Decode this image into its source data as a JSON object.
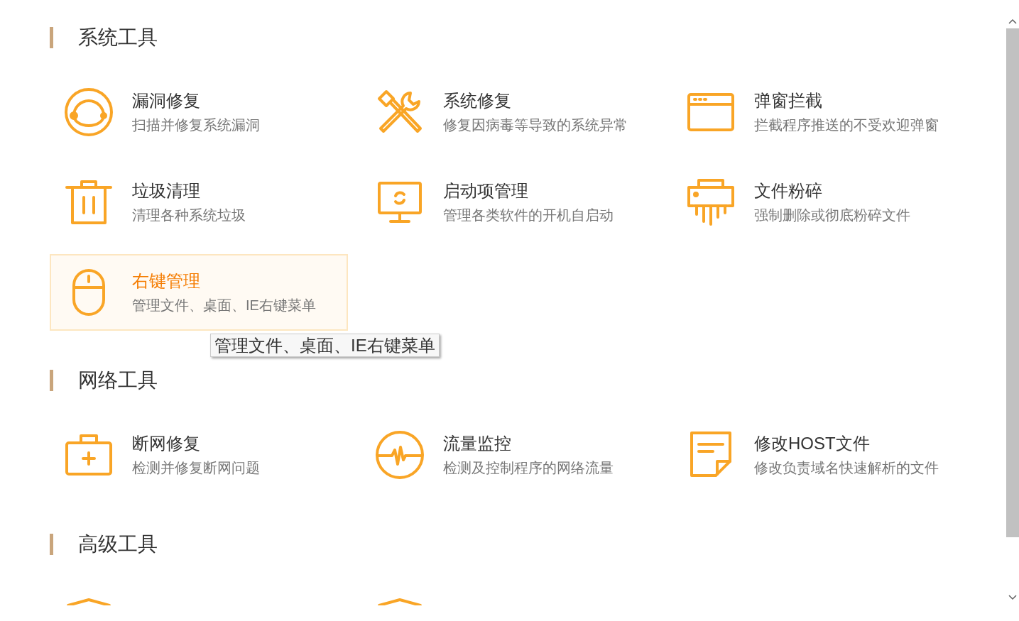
{
  "sections": [
    {
      "title": "系统工具",
      "tools": [
        {
          "kind": "vuln",
          "title": "漏洞修复",
          "desc": "扫描并修复系统漏洞",
          "hovered": false
        },
        {
          "kind": "tools",
          "title": "系统修复",
          "desc": "修复因病毒等导致的系统异常",
          "hovered": false
        },
        {
          "kind": "window",
          "title": "弹窗拦截",
          "desc": "拦截程序推送的不受欢迎弹窗",
          "hovered": false
        },
        {
          "kind": "trash",
          "title": "垃圾清理",
          "desc": "清理各种系统垃圾",
          "hovered": false
        },
        {
          "kind": "monitor",
          "title": "启动项管理",
          "desc": "管理各类软件的开机自启动",
          "hovered": false
        },
        {
          "kind": "shredder",
          "title": "文件粉碎",
          "desc": "强制删除或彻底粉碎文件",
          "hovered": false
        },
        {
          "kind": "mouse",
          "title": "右键管理",
          "desc": "管理文件、桌面、IE右键菜单",
          "hovered": true
        }
      ],
      "tooltip": "管理文件、桌面、IE右键菜单"
    },
    {
      "title": "网络工具",
      "tools": [
        {
          "kind": "medkit",
          "title": "断网修复",
          "desc": "检测并修复断网问题",
          "hovered": false
        },
        {
          "kind": "pulse",
          "title": "流量监控",
          "desc": "检测及控制程序的网络流量",
          "hovered": false
        },
        {
          "kind": "note",
          "title": "修改HOST文件",
          "desc": "修改负责域名快速解析的文件",
          "hovered": false
        }
      ]
    },
    {
      "title": "高级工具",
      "tools": [
        {
          "kind": "shield",
          "hovered": false
        },
        {
          "kind": "shield",
          "hovered": false
        }
      ]
    }
  ]
}
